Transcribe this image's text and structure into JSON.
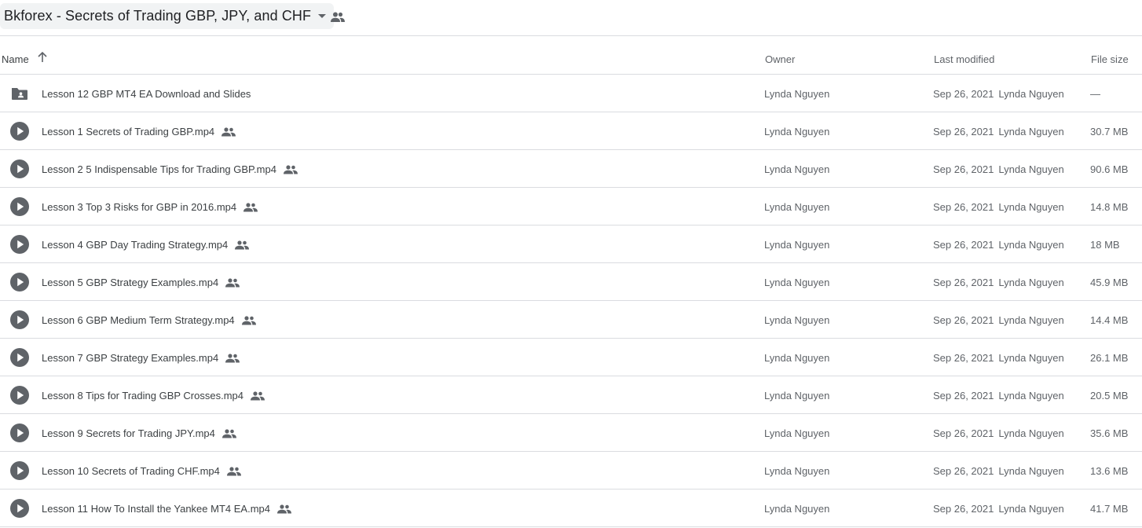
{
  "header": {
    "title": "Bkforex - Secrets of Trading GBP, JPY, and CHF"
  },
  "columns": {
    "name": "Name",
    "owner": "Owner",
    "last_modified": "Last modified",
    "file_size": "File size"
  },
  "icons": {
    "folder": "shared-folder-icon",
    "video": "video-play-icon",
    "shared": "people-icon",
    "sort": "arrow-up-icon",
    "dropdown": "caret-down-icon"
  },
  "colors": {
    "icon_gray": "#5f6368",
    "border": "#dadce0",
    "chip": "#f1f3f4"
  },
  "files": [
    {
      "name": "Lesson 12 GBP MT4 EA Download and Slides",
      "type": "folder",
      "shared": false,
      "owner": "Lynda Nguyen",
      "date": "Sep 26, 2021",
      "modified_by": "Lynda Nguyen",
      "size": "—"
    },
    {
      "name": "Lesson 1 Secrets of Trading GBP.mp4",
      "type": "video",
      "shared": true,
      "owner": "Lynda Nguyen",
      "date": "Sep 26, 2021",
      "modified_by": "Lynda Nguyen",
      "size": "30.7 MB"
    },
    {
      "name": "Lesson 2 5 Indispensable Tips for Trading GBP.mp4",
      "type": "video",
      "shared": true,
      "owner": "Lynda Nguyen",
      "date": "Sep 26, 2021",
      "modified_by": "Lynda Nguyen",
      "size": "90.6 MB"
    },
    {
      "name": "Lesson 3 Top 3 Risks for GBP in 2016.mp4",
      "type": "video",
      "shared": true,
      "owner": "Lynda Nguyen",
      "date": "Sep 26, 2021",
      "modified_by": "Lynda Nguyen",
      "size": "14.8 MB"
    },
    {
      "name": "Lesson 4 GBP Day Trading Strategy.mp4",
      "type": "video",
      "shared": true,
      "owner": "Lynda Nguyen",
      "date": "Sep 26, 2021",
      "modified_by": "Lynda Nguyen",
      "size": "18 MB"
    },
    {
      "name": "Lesson 5 GBP Strategy Examples.mp4",
      "type": "video",
      "shared": true,
      "owner": "Lynda Nguyen",
      "date": "Sep 26, 2021",
      "modified_by": "Lynda Nguyen",
      "size": "45.9 MB"
    },
    {
      "name": "Lesson 6 GBP Medium Term Strategy.mp4",
      "type": "video",
      "shared": true,
      "owner": "Lynda Nguyen",
      "date": "Sep 26, 2021",
      "modified_by": "Lynda Nguyen",
      "size": "14.4 MB"
    },
    {
      "name": "Lesson 7 GBP Strategy Examples.mp4",
      "type": "video",
      "shared": true,
      "owner": "Lynda Nguyen",
      "date": "Sep 26, 2021",
      "modified_by": "Lynda Nguyen",
      "size": "26.1 MB"
    },
    {
      "name": "Lesson 8 Tips for Trading GBP Crosses.mp4",
      "type": "video",
      "shared": true,
      "owner": "Lynda Nguyen",
      "date": "Sep 26, 2021",
      "modified_by": "Lynda Nguyen",
      "size": "20.5 MB"
    },
    {
      "name": "Lesson 9 Secrets for Trading JPY.mp4",
      "type": "video",
      "shared": true,
      "owner": "Lynda Nguyen",
      "date": "Sep 26, 2021",
      "modified_by": "Lynda Nguyen",
      "size": "35.6 MB"
    },
    {
      "name": "Lesson 10 Secrets of Trading CHF.mp4",
      "type": "video",
      "shared": true,
      "owner": "Lynda Nguyen",
      "date": "Sep 26, 2021",
      "modified_by": "Lynda Nguyen",
      "size": "13.6 MB"
    },
    {
      "name": "Lesson 11 How To Install the Yankee MT4 EA.mp4",
      "type": "video",
      "shared": true,
      "owner": "Lynda Nguyen",
      "date": "Sep 26, 2021",
      "modified_by": "Lynda Nguyen",
      "size": "41.7 MB"
    }
  ]
}
